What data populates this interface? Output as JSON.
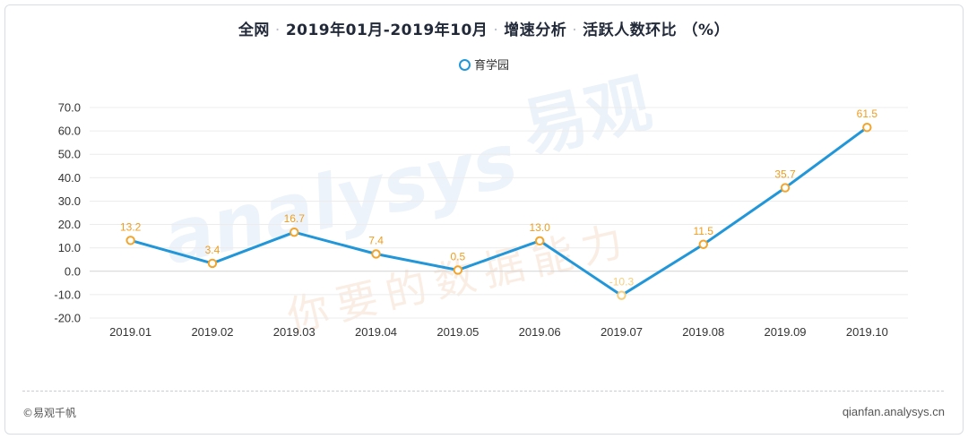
{
  "header": {
    "segments": [
      "全网",
      "2019年01月-2019年10月",
      "增速分析",
      "活跃人数环比 （%）"
    ],
    "separator": "·"
  },
  "legend": {
    "label": "育学园"
  },
  "watermark": {
    "latin": "analysys",
    "brand": "易观",
    "slogan": "你要的数据能力"
  },
  "footer": {
    "left": "©易观千帆",
    "right": "qianfan.analysys.cn"
  },
  "colors": {
    "line": "#2196d8",
    "marker": "#f2a52c",
    "label": "#ef9d1f",
    "negative_label": "#f6cf7e",
    "grid": "#ececec",
    "axis_text": "#333333"
  },
  "chart_data": {
    "type": "line",
    "categories": [
      "2019.01",
      "2019.02",
      "2019.03",
      "2019.04",
      "2019.05",
      "2019.06",
      "2019.07",
      "2019.08",
      "2019.09",
      "2019.10"
    ],
    "series": [
      {
        "name": "育学园",
        "values": [
          13.2,
          3.4,
          16.7,
          7.4,
          0.5,
          13.0,
          -10.3,
          11.5,
          35.7,
          61.5
        ]
      }
    ],
    "ylim": [
      -20,
      70
    ],
    "yticks": [
      -20,
      -10,
      0,
      10,
      20,
      30,
      40,
      50,
      60,
      70
    ],
    "ytick_decimals": 1,
    "grid": true,
    "legend_position": "top-center",
    "data_labels": true
  }
}
